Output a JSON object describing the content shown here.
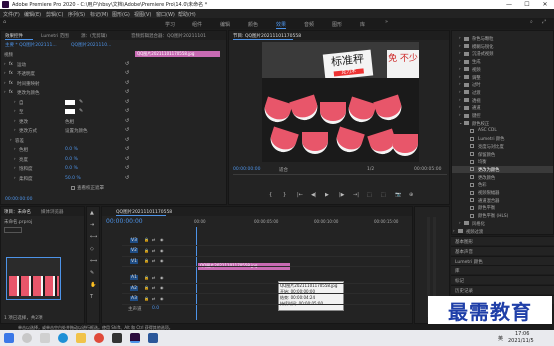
{
  "titlebar": {
    "title": "Adobe Premiere Pro 2020 - C:\\用户\\hbsy\\文档\\Adobe\\Premiere Pro\\14.0\\未命名 *",
    "min": "—",
    "max": "☐",
    "close": "✕"
  },
  "menu": [
    "文件(F)",
    "编辑(E)",
    "剪辑(C)",
    "序列(S)",
    "标记(M)",
    "图形(G)",
    "视图(V)",
    "窗口(W)",
    "帮助(H)"
  ],
  "workspaces": [
    "学习",
    "组件",
    "编辑",
    "颜色",
    "效果",
    "音频",
    "图形",
    "库"
  ],
  "active_workspace": "效果",
  "effect_controls": {
    "tabs": [
      "效果控件",
      "Lumetri 范围",
      "源：(无剪辑)",
      "音频剪辑混合器：QQ图片20211101"
    ],
    "source_label": "主要 * QQ图片202111...",
    "seq_label": "QQ图片2021110...",
    "mini_clip": "QQ图片20211101170558.jpg",
    "timecode": "00:00:00:00",
    "rows": [
      {
        "label": "视频",
        "type": "header"
      },
      {
        "label": "运动",
        "type": "fx"
      },
      {
        "label": "不透明度",
        "type": "fx"
      },
      {
        "label": "时间重映射",
        "type": "fx"
      },
      {
        "label": "更改为颜色",
        "type": "fx"
      },
      {
        "label": "自",
        "value": "",
        "type": "swatch"
      },
      {
        "label": "至",
        "value": "",
        "type": "swatch"
      },
      {
        "label": "更改",
        "value": "色相",
        "type": "select"
      },
      {
        "label": "更改方式",
        "value": "设置为颜色",
        "type": "select"
      },
      {
        "label": "容差",
        "type": "sub"
      },
      {
        "label": "色相",
        "value": "0.0 %",
        "type": "prop"
      },
      {
        "label": "亮度",
        "value": "0.0 %",
        "type": "prop"
      },
      {
        "label": "饱和度",
        "value": "0.0 %",
        "type": "prop"
      },
      {
        "label": "柔和度",
        "value": "50.0 %",
        "type": "prop"
      },
      {
        "label": "",
        "value": "查看校正遮罩",
        "type": "check"
      }
    ]
  },
  "program": {
    "tab": "节目: QQ图片20211101170558",
    "timecode_left": "00:00:00:00",
    "fit": "适合",
    "ratio": "1/2",
    "timecode_right": "00:00:05:00",
    "sign_text": "标准秤",
    "sign_small": "克力木",
    "sign_right": "免 不少",
    "transport": [
      "{",
      "}",
      "|←",
      "◀|",
      "▶",
      "|▶",
      "→|",
      "⬚",
      "⬚",
      "📷",
      "⊕"
    ]
  },
  "project": {
    "tabs": [
      "项目：未命名",
      "媒体浏览器"
    ],
    "file_label": "未命名.prproj",
    "count": "1 项已选择，共2项"
  },
  "timeline": {
    "tab": "QQ图片20211101170558",
    "timecode": "00:00:00:00",
    "ruler": [
      "00:00",
      "00:00:05:00",
      "00:00:10:00",
      "00:00:15:00"
    ],
    "tracks": [
      {
        "name": "V3"
      },
      {
        "name": "V2"
      },
      {
        "name": "V1"
      },
      {
        "name": "A1"
      },
      {
        "name": "A2"
      },
      {
        "name": "A3"
      }
    ],
    "master": "主声道",
    "master_val": "0.0",
    "clip": "QQ图片20211101170558.jpg",
    "tooltip": [
      "QQ图片20211101170558.jpg",
      "开始: 00:00:00:00",
      "结束: 00:00:04:24",
      "持续时间: 00:00:05:00"
    ]
  },
  "effects_tree": {
    "items": [
      {
        "label": "杂色与颗粒",
        "level": 1,
        "open": false
      },
      {
        "label": "模糊与锐化",
        "level": 1,
        "open": false
      },
      {
        "label": "沉浸式视频",
        "level": 1,
        "open": false
      },
      {
        "label": "生成",
        "level": 1,
        "open": false
      },
      {
        "label": "视频",
        "level": 1,
        "open": false
      },
      {
        "label": "调整",
        "level": 1,
        "open": false
      },
      {
        "label": "过时",
        "level": 1,
        "open": false
      },
      {
        "label": "过渡",
        "level": 1,
        "open": false
      },
      {
        "label": "透视",
        "level": 1,
        "open": false
      },
      {
        "label": "通道",
        "level": 1,
        "open": false
      },
      {
        "label": "键控",
        "level": 1,
        "open": false
      },
      {
        "label": "颜色校正",
        "level": 1,
        "open": true
      },
      {
        "label": "ASC CDL",
        "level": 2
      },
      {
        "label": "Lumetri 颜色",
        "level": 2
      },
      {
        "label": "亮度与对比度",
        "level": 2
      },
      {
        "label": "保留颜色",
        "level": 2
      },
      {
        "label": "均衡",
        "level": 2
      },
      {
        "label": "更改为颜色",
        "level": 2,
        "selected": true
      },
      {
        "label": "更改颜色",
        "level": 2
      },
      {
        "label": "色彩",
        "level": 2
      },
      {
        "label": "视频限幅器",
        "level": 2
      },
      {
        "label": "通道混合器",
        "level": 2
      },
      {
        "label": "颜色平衡",
        "level": 2
      },
      {
        "label": "颜色平衡 (HLS)",
        "level": 2
      },
      {
        "label": "风格化",
        "level": 1,
        "open": false
      },
      {
        "label": "视频过渡",
        "level": 0,
        "open": false
      }
    ],
    "panels": [
      "基本图形",
      "基本声音",
      "Lumetri 颜色",
      "库",
      "标记",
      "历史记录",
      "信息"
    ]
  },
  "statusbar": "单击以选择，或单击空白处并拖动以进行框选。使用 Shift、Alt 和 Ctrl 获得其他选项。",
  "watermark": "最需教育",
  "taskbar": {
    "time": "17:06",
    "date": "2021/11/5",
    "lang": "英",
    "icons": [
      "windows-icon",
      "search-icon",
      "taskview-icon",
      "edge-icon",
      "explorer-icon",
      "chrome-icon",
      "app-icon",
      "premiere-icon",
      "word-icon"
    ]
  },
  "colors": {
    "accent": "#4d93e8",
    "clip": "#c86bb3",
    "panel": "#232323",
    "watermelon": "#e8566a"
  }
}
